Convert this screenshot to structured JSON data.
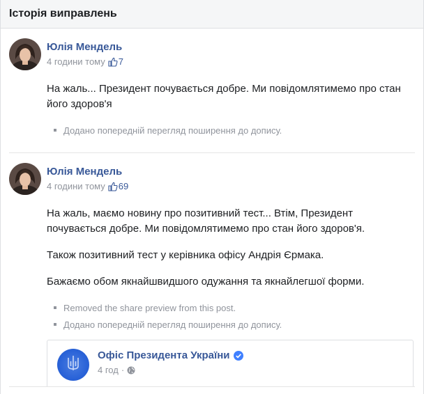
{
  "header": {
    "title": "Історія виправлень"
  },
  "entries": [
    {
      "author": "Юлія Мендель",
      "time": "4 години тому",
      "likes": "7",
      "paragraphs": [
        "На жаль... Президент почувається добре. Ми повідомлятимемо про стан його здоров'я"
      ],
      "edits": [
        "Додано попередній перегляд поширення до допису."
      ]
    },
    {
      "author": "Юлія Мендель",
      "time": "4 години тому",
      "likes": "69",
      "paragraphs": [
        "На жаль, маємо новину про позитивний тест... Втім, Президент почувається добре. Ми повідомлятимемо про стан його здоров'я.",
        "Також позитивний тест у керівника офісу Андрія Єрмака.",
        "Бажаємо обом якнайшвидшого одужання та якнайлегшої форми."
      ],
      "edits": [
        "Removed the share preview from this post.",
        "Додано попередній перегляд поширення до допису."
      ],
      "shared": {
        "page_name": "Офіс Президента України",
        "time": "4 год",
        "separator": "·"
      }
    }
  ],
  "colors": {
    "link": "#385898",
    "meta": "#90949c",
    "header_bg": "#f5f6f7",
    "page_avatar": "#2a63d8"
  },
  "icons": [
    "thumbs-up-icon",
    "verified-badge-icon",
    "globe-icon",
    "trident-icon"
  ]
}
